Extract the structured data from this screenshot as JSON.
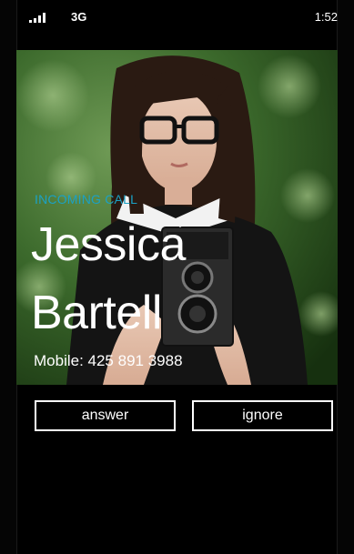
{
  "status_bar": {
    "network": "3G",
    "time": "1:52",
    "signal_icon": "signal-bars-icon"
  },
  "call": {
    "label": "INCOMING CALL",
    "name_first": "Jessica",
    "name_last": "Bartell",
    "number": "Mobile: 425 891 3988",
    "accent_color": "#1ba1c5"
  },
  "actions": {
    "answer_label": "answer",
    "ignore_label": "ignore"
  }
}
